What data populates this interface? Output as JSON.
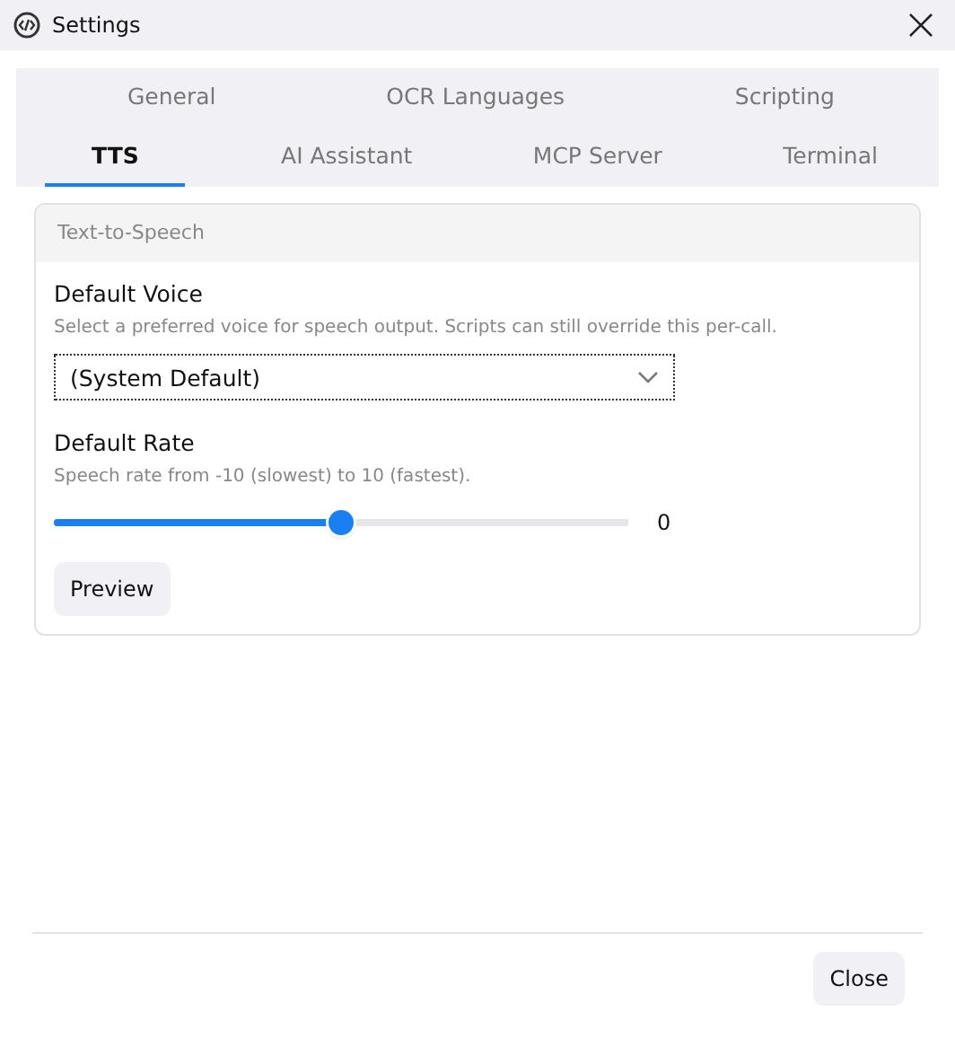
{
  "window": {
    "title": "Settings"
  },
  "tab_rows": [
    [
      {
        "label": "General",
        "selected": false
      },
      {
        "label": "OCR Languages",
        "selected": false
      },
      {
        "label": "Scripting",
        "selected": false
      }
    ],
    [
      {
        "label": "TTS",
        "selected": true
      },
      {
        "label": "AI Assistant",
        "selected": false
      },
      {
        "label": "MCP Server",
        "selected": false
      },
      {
        "label": "Terminal",
        "selected": false
      }
    ]
  ],
  "section": {
    "title": "Text-to-Speech",
    "voice": {
      "label": "Default Voice",
      "hint": "Select a preferred voice for speech output. Scripts can still override this per-call.",
      "value": "(System Default)"
    },
    "rate": {
      "label": "Default Rate",
      "hint": "Speech rate from -10 (slowest) to 10 (fastest).",
      "level": 0.5,
      "reading": "0"
    },
    "preview_button": "Preview"
  },
  "footer": {
    "close_button": "Close"
  }
}
